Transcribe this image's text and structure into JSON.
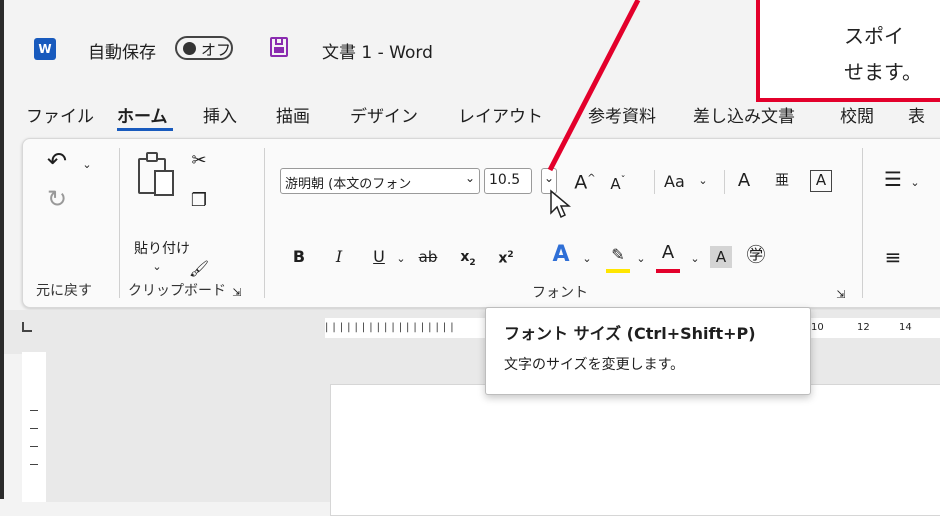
{
  "titlebar": {
    "app_icon": "word-icon",
    "autosave_label": "自動保存",
    "autosave_state": "オフ",
    "save_icon": "save-icon",
    "doc_title": "文書 1 - Word"
  },
  "menu_tabs": [
    "ファイル",
    "ホーム",
    "挿入",
    "描画",
    "デザイン",
    "レイアウト",
    "参考資料",
    "差し込み文書",
    "校閲",
    "表"
  ],
  "active_tab": "ホーム",
  "ribbon": {
    "undo_group_label": "元に戻す",
    "clipboard_group_label": "クリップボード",
    "paste_label": "貼り付け",
    "font_group_label": "フォント",
    "font_name": "游明朝 (本文のフォン",
    "font_size": "10.5",
    "change_case_label": "Aa",
    "highlight_color": "#ffe600",
    "font_color": "#e3002b",
    "accent_color": "#185abd"
  },
  "ruler": {
    "tick_10": "10",
    "tick_12": "12",
    "tick_14": "14"
  },
  "tooltip": {
    "title": "フォント サイズ (Ctrl+Shift+P)",
    "description": "文字のサイズを変更します。"
  },
  "callout": {
    "line1": "スポイ",
    "line2": "せます。",
    "border_color": "#e3002b"
  }
}
